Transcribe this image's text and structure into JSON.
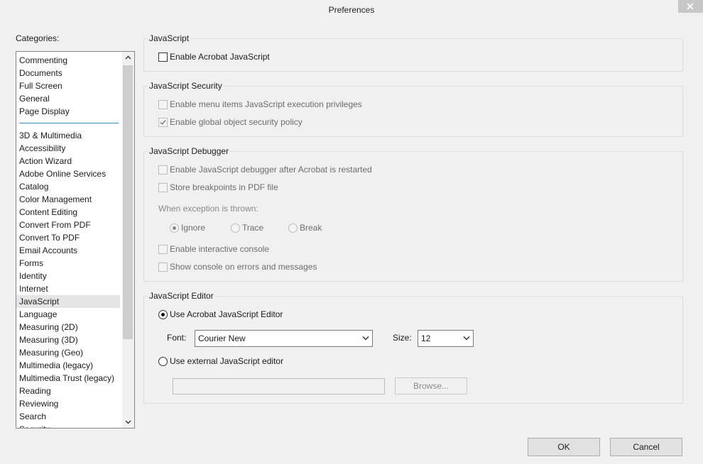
{
  "window": {
    "title": "Preferences"
  },
  "categories": {
    "label": "Categories:",
    "group_top": [
      "Commenting",
      "Documents",
      "Full Screen",
      "General",
      "Page Display"
    ],
    "group_bottom": [
      "3D & Multimedia",
      "Accessibility",
      "Action Wizard",
      "Adobe Online Services",
      "Catalog",
      "Color Management",
      "Content Editing",
      "Convert From PDF",
      "Convert To PDF",
      "Email Accounts",
      "Forms",
      "Identity",
      "Internet",
      "JavaScript",
      "Language",
      "Measuring (2D)",
      "Measuring (3D)",
      "Measuring (Geo)",
      "Multimedia (legacy)",
      "Multimedia Trust (legacy)",
      "Reading",
      "Reviewing",
      "Search",
      "Security"
    ],
    "selected": "JavaScript"
  },
  "javascript": {
    "title": "JavaScript",
    "enable_label": "Enable Acrobat JavaScript",
    "enable_checked": false
  },
  "security": {
    "title": "JavaScript Security",
    "menu_priv_label": "Enable menu items JavaScript execution privileges",
    "menu_priv_checked": false,
    "global_policy_label": "Enable global object security policy",
    "global_policy_checked": true
  },
  "debugger": {
    "title": "JavaScript Debugger",
    "enable_debugger_label": "Enable JavaScript debugger after Acrobat is restarted",
    "store_breakpoints_label": "Store breakpoints in PDF file",
    "exception_label": "When exception is thrown:",
    "exception_options": [
      "Ignore",
      "Trace",
      "Break"
    ],
    "exception_selected": "Ignore",
    "interactive_console_label": "Enable interactive console",
    "show_console_label": "Show console on errors and messages"
  },
  "editor": {
    "title": "JavaScript Editor",
    "use_acrobat_label": "Use Acrobat JavaScript Editor",
    "use_acrobat_selected": true,
    "font_label": "Font:",
    "font_value": "Courier New",
    "size_label": "Size:",
    "size_value": "12",
    "use_external_label": "Use external JavaScript editor",
    "external_path": "",
    "browse_label": "Browse..."
  },
  "footer": {
    "ok_label": "OK",
    "cancel_label": "Cancel"
  },
  "colors": {
    "separator": "#3c90c4",
    "selection": "#e5e5e5"
  }
}
